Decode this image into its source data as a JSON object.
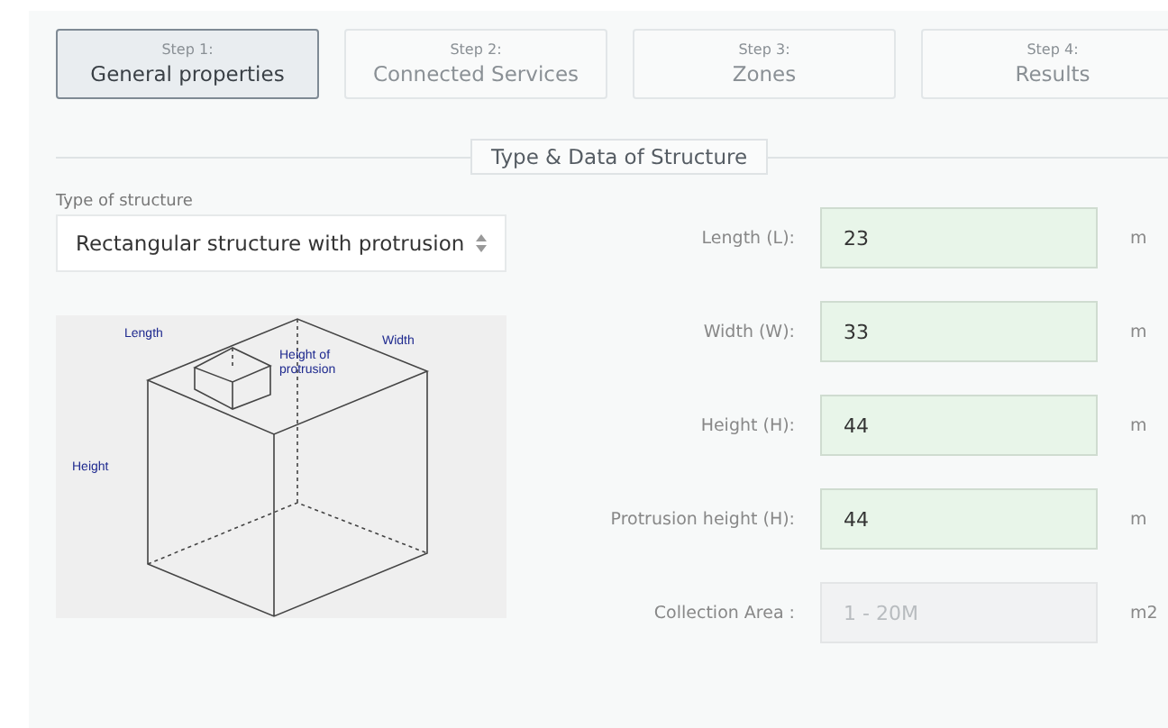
{
  "steps": [
    {
      "step": "Step 1:",
      "label": "General properties",
      "selected": true
    },
    {
      "step": "Step 2:",
      "label": "Connected Services",
      "selected": false
    },
    {
      "step": "Step 3:",
      "label": "Zones",
      "selected": false
    },
    {
      "step": "Step 4:",
      "label": "Results",
      "selected": false
    }
  ],
  "section_title": "Type & Data of Structure",
  "structure_type": {
    "label": "Type of structure",
    "value": "Rectangular structure with protrusion"
  },
  "diagram_labels": {
    "length": "Length",
    "width": "Width",
    "protrusion": [
      "Height of",
      "protrusion"
    ],
    "height": "Height"
  },
  "fields": [
    {
      "label": "Length (L):",
      "value": "23",
      "unit": "m",
      "disabled": false
    },
    {
      "label": "Width (W):",
      "value": "33",
      "unit": "m",
      "disabled": false
    },
    {
      "label": "Height (H):",
      "value": "44",
      "unit": "m",
      "disabled": false
    },
    {
      "label": "Protrusion height (H):",
      "value": "44",
      "unit": "m",
      "disabled": false
    },
    {
      "label": "Collection Area :",
      "placeholder": "1 - 20M",
      "unit": "m2",
      "disabled": true
    }
  ]
}
